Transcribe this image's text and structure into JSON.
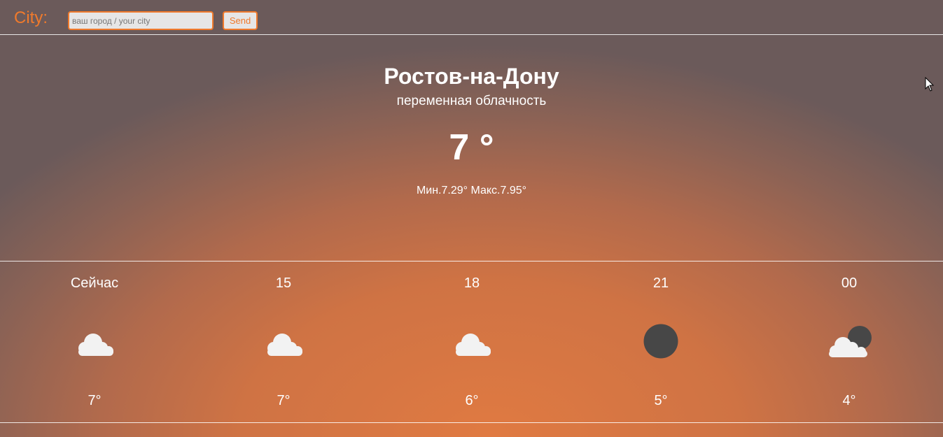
{
  "header": {
    "city_label": "City:",
    "search_placeholder": "ваш город / your city",
    "search_value": "",
    "send_label": "Send"
  },
  "current": {
    "city": "Ростов-на-Дону",
    "description": "переменная облачность",
    "temperature": "7 °",
    "minmax": "Мин.7.29° Макс.7.95°"
  },
  "forecast": [
    {
      "time": "Сейчас",
      "icon": "cloud-icon",
      "temp": "7°"
    },
    {
      "time": "15",
      "icon": "cloud-icon",
      "temp": "7°"
    },
    {
      "time": "18",
      "icon": "cloud-icon",
      "temp": "6°"
    },
    {
      "time": "21",
      "icon": "moon-icon",
      "temp": "5°"
    },
    {
      "time": "00",
      "icon": "moon-cloud-icon",
      "temp": "4°"
    }
  ],
  "colors": {
    "accent": "#f07a2c",
    "icon_light": "#f2f2f2",
    "icon_dark": "#474747"
  }
}
